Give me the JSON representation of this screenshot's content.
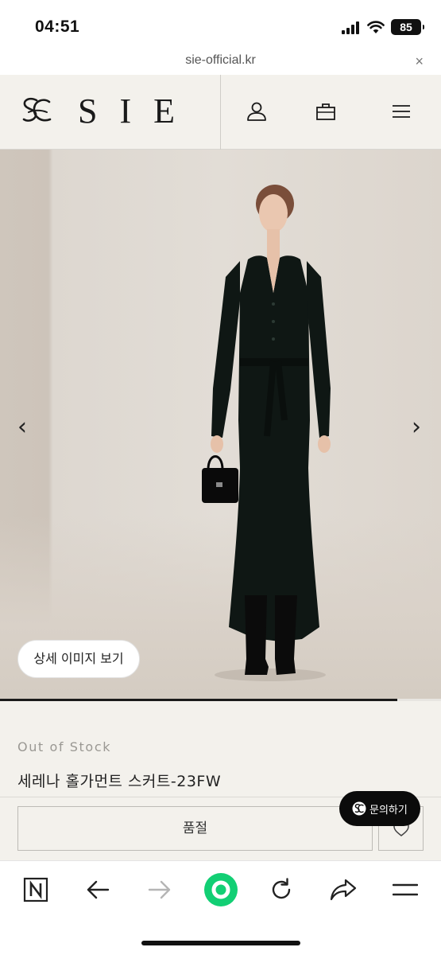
{
  "status_bar": {
    "time": "04:51",
    "battery": "85"
  },
  "browser": {
    "url": "sie-official.kr",
    "close_glyph": "×"
  },
  "site": {
    "brand": "SIE",
    "logo_icon": "sie-monogram-icon"
  },
  "header_icons": [
    "user-icon",
    "bag-icon",
    "menu-icon"
  ],
  "hero": {
    "prev_glyph": "‹",
    "next_glyph": "›",
    "detail_button": "상세 이미지 보기",
    "carousel_progress": 0.9
  },
  "product": {
    "stock_status": "Out of Stock",
    "name": "세레나 홀가먼트 스커트-23FW",
    "sold_out_button": "품절",
    "inquiry_button": "문의하기"
  },
  "toolbar_icons": [
    "naver-n-icon",
    "back-arrow-icon",
    "forward-arrow-icon",
    "green-home-icon",
    "reload-icon",
    "share-icon",
    "menu-lines-icon"
  ]
}
